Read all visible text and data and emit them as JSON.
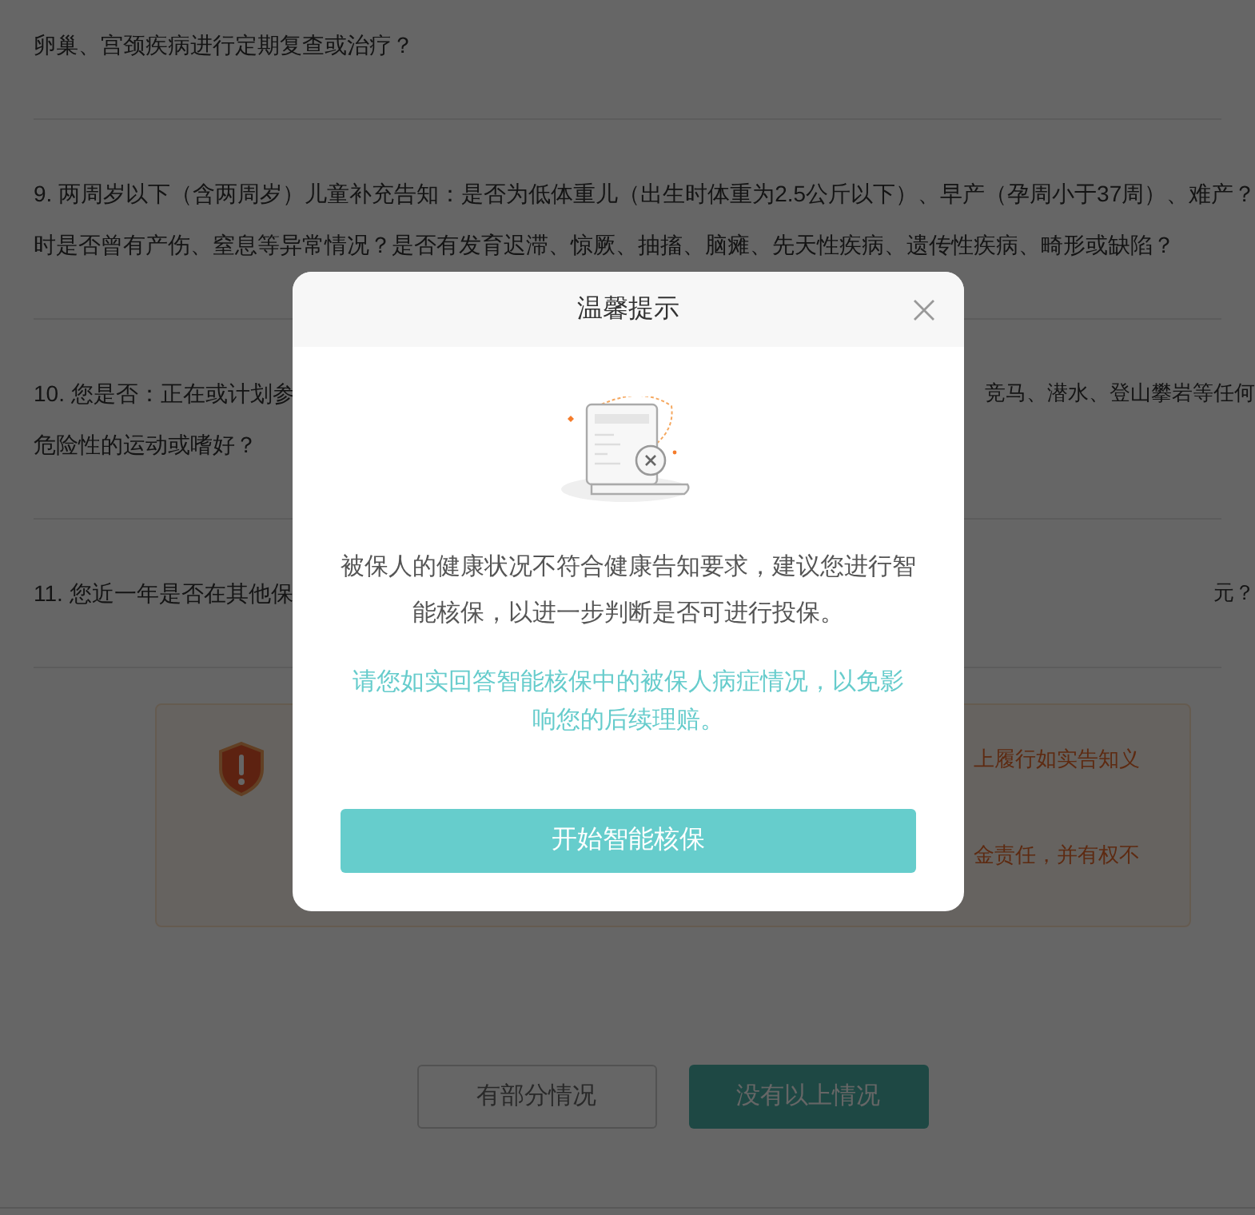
{
  "questions": [
    {
      "lines": [
        {
          "left": "卵巢、宫颈疾病进行定期复查或治疗？"
        }
      ]
    },
    {
      "lines": [
        {
          "left": "9. 两周岁以下（含两周岁）儿童补充告知：是否为低体重儿（出生时体重为2.5公斤以下）、早产（孕周小于37周）、难产？"
        },
        {
          "left": "时是否曾有产伤、窒息等异常情况？是否有发育迟滞、惊厥、抽搐、脑瘫、先天性疾病、遗传性疾病、畸形或缺陷？"
        }
      ]
    },
    {
      "lines": [
        {
          "left": "10. 您是否：正在或计划参",
          "right": "竞马、潜水、登山攀岩等任何"
        },
        {
          "left": "危险性的运动或嗜好？"
        }
      ]
    },
    {
      "lines": [
        {
          "left": "11. 您近一年是否在其他保",
          "right": "元？"
        }
      ]
    }
  ],
  "notice": {
    "lines": [
      "上履行如实告知义",
      "金责任，并有权不"
    ]
  },
  "buttons": [
    {
      "label": "有部分情况",
      "kind": "outline"
    },
    {
      "label": "没有以上情况",
      "kind": "primary"
    }
  ],
  "dialog": {
    "title": "温馨提示",
    "message": "被保人的健康状况不符合健康告知要求，建议您进行智能核保，以进一步判断是否可进行投保。",
    "hint": "请您如实回答智能核保中的被保人病症情况，以免影响您的后续理赔。",
    "action": "开始智能核保"
  }
}
